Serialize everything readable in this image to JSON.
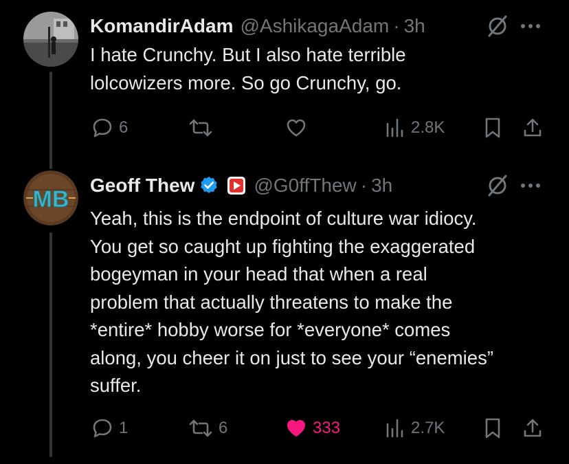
{
  "tweets": [
    {
      "name": "KomandirAdam",
      "handle": "@AshikagaAdam",
      "separator": "·",
      "time": "3h",
      "text_lines": [
        "I hate Crunchy. But I also hate terrible",
        "lolcowizers more. So go Crunchy, go."
      ],
      "replies": "6",
      "reposts": "",
      "likes": "",
      "views": "2.8K",
      "liked": false
    },
    {
      "name": "Geoff Thew",
      "handle": "@G0ffThew",
      "separator": "·",
      "time": "3h",
      "verified": true,
      "text_lines": [
        "Yeah, this is the endpoint of culture war idiocy.",
        "You get so caught up fighting the exaggerated",
        "bogeyman in your head that when a real",
        "problem that actually threatens to make the",
        "*entire* hobby worse for *everyone* comes",
        "along, you cheer it on just to see your “enemies”",
        "suffer."
      ],
      "replies": "1",
      "reposts": "6",
      "likes": "333",
      "views": "2.7K",
      "liked": true,
      "avatar_text": "MB"
    }
  ],
  "colors": {
    "background": "#000000",
    "text": "#e7e9ea",
    "muted": "#71767b",
    "like": "#f91880",
    "verified": "#1d9bf0"
  }
}
